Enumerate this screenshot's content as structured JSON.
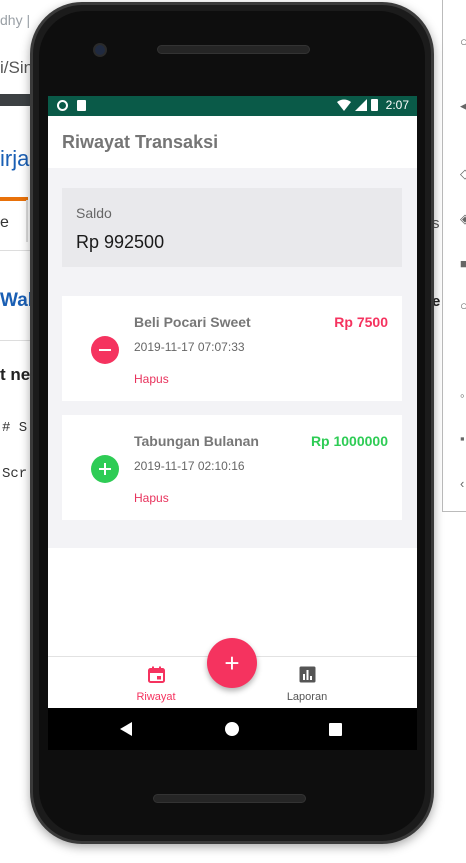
{
  "background": {
    "url_frag_1": "dhy |",
    "url_frag_2": "i/Sin",
    "link_frag_1": "irja",
    "tab_frag": "e",
    "link_frag_2": "Wal",
    "heading_frag": "t ne",
    "code_frag_1": "# S",
    "code_frag_2": "Scr",
    "right_frag_1": "s",
    "right_frag_2": "e"
  },
  "status_bar": {
    "time": "2:07"
  },
  "app": {
    "title": "Riwayat Transaksi"
  },
  "saldo": {
    "label": "Saldo",
    "value": "Rp 992500"
  },
  "transactions": [
    {
      "title": "Beli Pocari Sweet",
      "date": "2019-11-17 07:07:33",
      "amount": "Rp 7500",
      "type": "expense",
      "icon": "minus-icon",
      "delete_label": "Hapus",
      "color": "#f5335f"
    },
    {
      "title": "Tabungan Bulanan",
      "date": "2019-11-17 02:10:16",
      "amount": "Rp 1000000",
      "type": "income",
      "icon": "plus-icon",
      "delete_label": "Hapus",
      "color": "#2ecc55"
    }
  ],
  "fab": {
    "icon": "plus-icon",
    "symbol": "+"
  },
  "bottom_nav": {
    "items": [
      {
        "label": "Riwayat",
        "icon": "calendar-icon",
        "active": true,
        "color": "#f5335f"
      },
      {
        "label": "Laporan",
        "icon": "bar-chart-icon",
        "active": false,
        "color": "#555555"
      }
    ]
  },
  "colors": {
    "status_bar": "#0a5a48",
    "accent": "#f5335f",
    "income": "#2ecc55",
    "expense": "#f5335f"
  }
}
